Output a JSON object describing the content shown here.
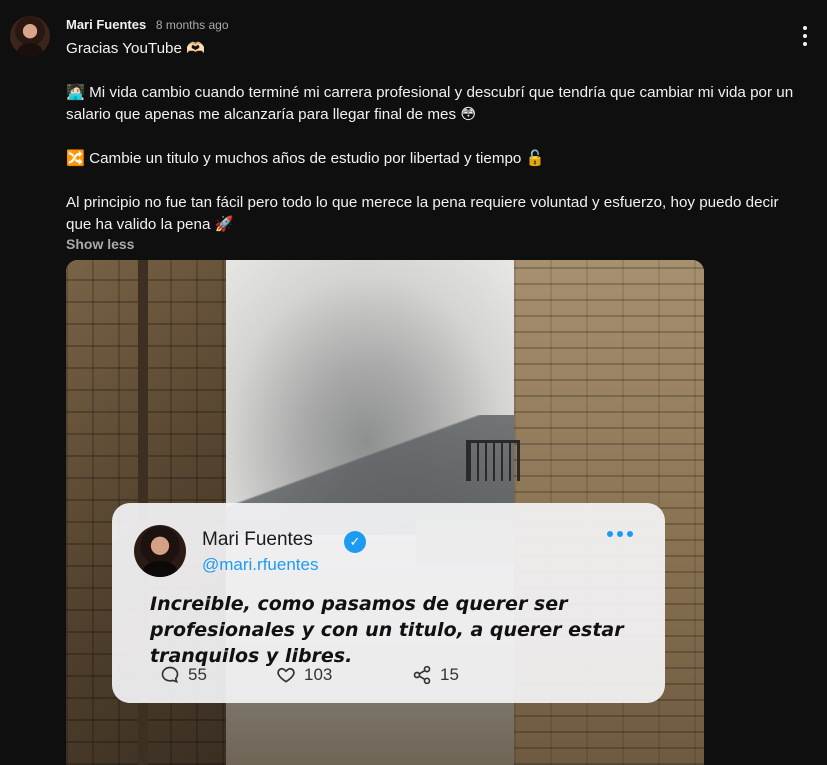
{
  "comment": {
    "author": "Mari Fuentes",
    "time": "8 months ago",
    "lines": {
      "l1": "Gracias YouTube 🫶🏻",
      "l2": "🧑🏻‍💻 Mi vida cambio cuando terminé mi carrera profesional y descubrí que tendría que cambiar mi vida por un salario que apenas me alcanzaría para llegar final de mes 😳",
      "l3": "🔀 Cambie un titulo y muchos años de estudio por libertad y tiempo 🔓",
      "l4": "Al principio no fue tan fácil pero todo lo que merece la pena requiere voluntad y esfuerzo, hoy puedo decir que ha valido la pena 🚀"
    },
    "show_less": "Show less"
  },
  "post_card": {
    "name": "Mari Fuentes",
    "verified_icon": "✓",
    "handle": "@mari.rfuentes",
    "text": "Increible, como pasamos de querer ser profesionales y con un titulo, a querer estar tranquilos y libres.",
    "stats": {
      "comments": "55",
      "likes": "103",
      "shares": "15"
    }
  },
  "icons": {
    "menu": "more-vertical-icon",
    "comment": "comment-bubble-icon",
    "like": "heart-icon",
    "share": "share-icon",
    "card_more": "more-horizontal-icon"
  },
  "colors": {
    "background": "#0f0f0f",
    "accent_blue": "#1d9bf0"
  }
}
